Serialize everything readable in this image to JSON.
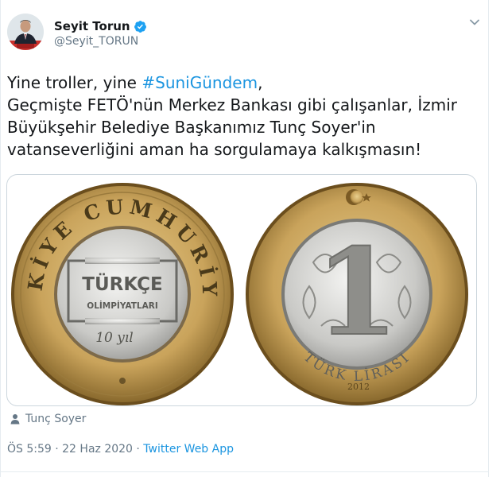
{
  "user": {
    "display_name": "Seyit Torun",
    "handle": "@Seyit_TORUN",
    "verified": true
  },
  "tweet": {
    "text_before_hashtag": "Yine troller, yine ",
    "hashtag": "#SuniGündem",
    "text_after_hashtag": ",\nGeçmişte FETÖ'nün Merkez Bankası gibi çalışanlar, İzmir Büyükşehir Belediye Başkanımız Tunç Soyer'in vatanseverliğini aman ha sorgulamaya kalkışmasın!"
  },
  "media": {
    "coin_left": {
      "ring_text": "TÜRKİYE CUMHURİYETİ",
      "center_line1": "TÜRKÇE",
      "center_line2": "OLİMPİYATLARI",
      "center_line3": "10 yıl"
    },
    "coin_right": {
      "value": "1",
      "ring_text": "TÜRK LİRASI",
      "year": "2012"
    }
  },
  "tagged_user": "Tunç Soyer",
  "meta": {
    "time_date": "ÖS 5:59 · 22 Haz 2020 · ",
    "source": "Twitter Web App"
  },
  "colors": {
    "link": "#1b95e0",
    "text": "#14171a",
    "secondary": "#657786",
    "border": "#ccd6dd"
  },
  "icons": {
    "verified": "verified-badge-icon",
    "caret": "chevron-down-icon",
    "person": "person-icon"
  }
}
